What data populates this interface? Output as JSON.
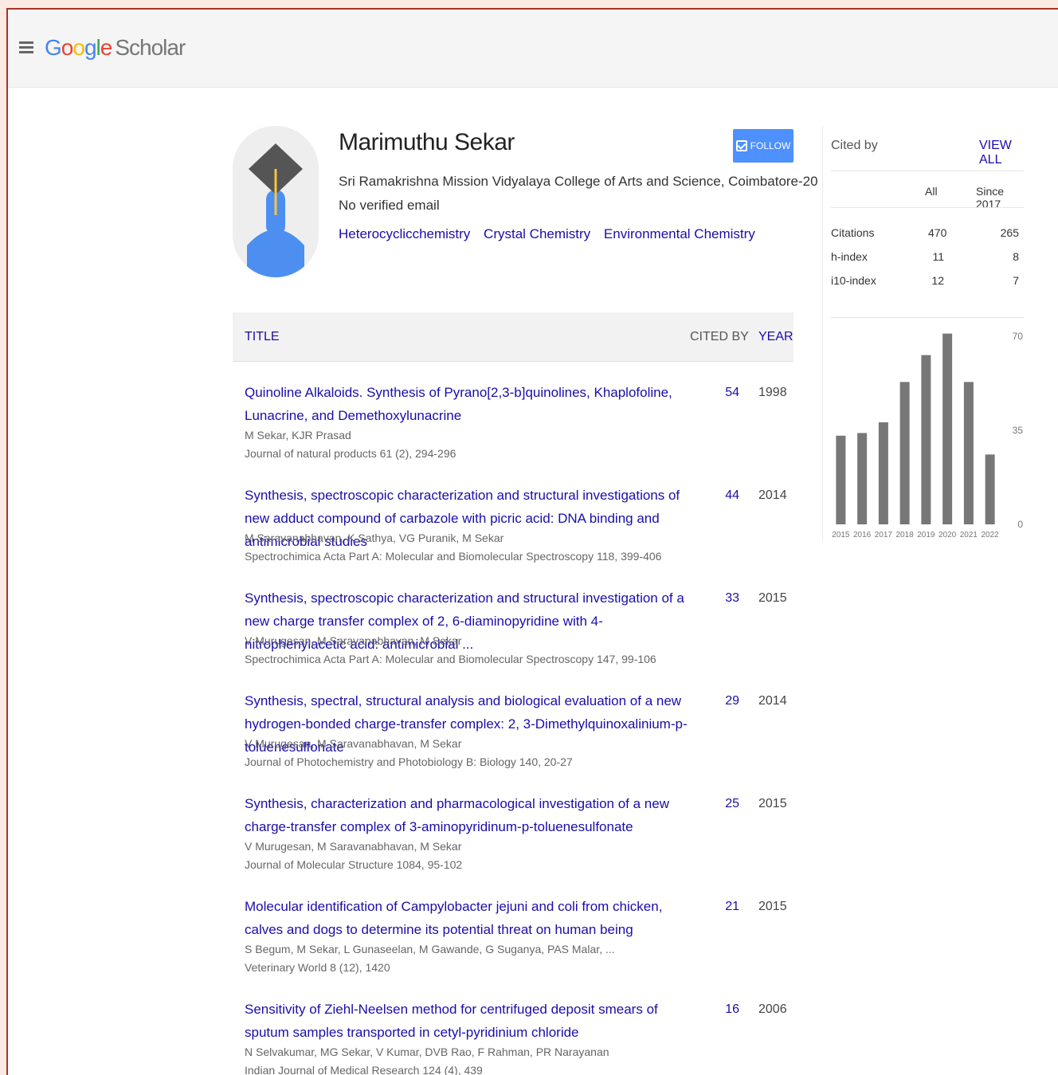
{
  "header": {
    "menu_icon": "hamburger-menu-icon",
    "logo": {
      "g": "G",
      "o1": "o",
      "o2": "o",
      "g2": "g",
      "l": "l",
      "e": "e",
      "scholar": "Scholar"
    }
  },
  "profile": {
    "name": "Marimuthu Sekar",
    "affiliation": "Sri Ramakrishna Mission Vidyalaya College of Arts and Science, Coimbatore-20",
    "email": "No verified email",
    "interests": [
      "Heterocyclicchemistry",
      "Crystal Chemistry",
      "Environmental Chemistry"
    ],
    "follow_label": "FOLLOW",
    "avatar_icon": "graduate-avatar-icon"
  },
  "table": {
    "headers": {
      "title": "TITLE",
      "cited_by": "CITED BY",
      "year": "YEAR"
    },
    "articles": [
      {
        "title": "Quinoline Alkaloids. Synthesis of Pyrano[2,3-b]quinolines, Khaplofoline, Lunacrine, and Demethoxylunacrine",
        "authors": "M Sekar, KJR Prasad",
        "venue": "Journal of natural products 61 (2), 294-296",
        "cited_by": "54",
        "year": "1998"
      },
      {
        "title": "Synthesis, spectroscopic characterization and structural investigations of new adduct compound of carbazole with picric acid: DNA binding and antimicrobial studies",
        "authors": "M Saravanabhavan, K Sathya, VG Puranik, M Sekar",
        "venue": "Spectrochimica Acta Part A: Molecular and Biomolecular Spectroscopy 118, 399-406",
        "cited_by": "44",
        "year": "2014"
      },
      {
        "title": "Synthesis, spectroscopic characterization and structural investigation of a new charge transfer complex of 2, 6-diaminopyridine with 4-nitrophenylacetic acid: antimicrobial ...",
        "authors": "V Murugesan, M Saravanabhavan, M Sekar",
        "venue": "Spectrochimica Acta Part A: Molecular and Biomolecular Spectroscopy 147, 99-106",
        "cited_by": "33",
        "year": "2015"
      },
      {
        "title": "Synthesis, spectral, structural analysis and biological evaluation of a new hydrogen-bonded charge-transfer complex: 2, 3-Dimethylquinoxalinium-p-toluenesulfonate",
        "authors": "V Murugesan, M Saravanabhavan, M Sekar",
        "venue": "Journal of Photochemistry and Photobiology B: Biology 140, 20-27",
        "cited_by": "29",
        "year": "2014"
      },
      {
        "title": "Synthesis, characterization and pharmacological investigation of a new charge-transfer complex of 3-aminopyridinum-p-toluenesulfonate",
        "authors": "V Murugesan, M Saravanabhavan, M Sekar",
        "venue": "Journal of Molecular Structure 1084, 95-102",
        "cited_by": "25",
        "year": "2015"
      },
      {
        "title": "Molecular identification of Campylobacter jejuni and coli from chicken, calves and dogs to determine its potential threat on human being",
        "authors": "S Begum, M Sekar, L Gunaseelan, M Gawande, G Suganya, PAS Malar, ...",
        "venue": "Veterinary World 8 (12), 1420",
        "cited_by": "21",
        "year": "2015"
      },
      {
        "title": "Sensitivity of Ziehl-Neelsen method for centrifuged deposit smears of sputum samples transported in cetyl-pyridinium chloride",
        "authors": "N Selvakumar, MG Sekar, V Kumar, DVB Rao, F Rahman, PR Narayanan",
        "venue": "Indian Journal of Medical Research 124 (4), 439",
        "cited_by": "16",
        "year": "2006"
      }
    ]
  },
  "cited_by": {
    "title": "Cited by",
    "view_all": "VIEW ALL",
    "col_all": "All",
    "col_since": "Since 2017",
    "rows": [
      {
        "label": "Citations",
        "all": "470",
        "since": "265"
      },
      {
        "label": "h-index",
        "all": "11",
        "since": "8"
      },
      {
        "label": "i10-index",
        "all": "12",
        "since": "7"
      }
    ]
  },
  "chart_data": {
    "type": "bar",
    "categories": [
      "2015",
      "2016",
      "2017",
      "2018",
      "2019",
      "2020",
      "2021",
      "2022"
    ],
    "values": [
      33,
      34,
      38,
      53,
      63,
      71,
      53,
      26
    ],
    "ylim": [
      0,
      70
    ],
    "yticks": [
      "70",
      "35",
      "0"
    ],
    "bar_color": "#777777",
    "grid": false
  }
}
